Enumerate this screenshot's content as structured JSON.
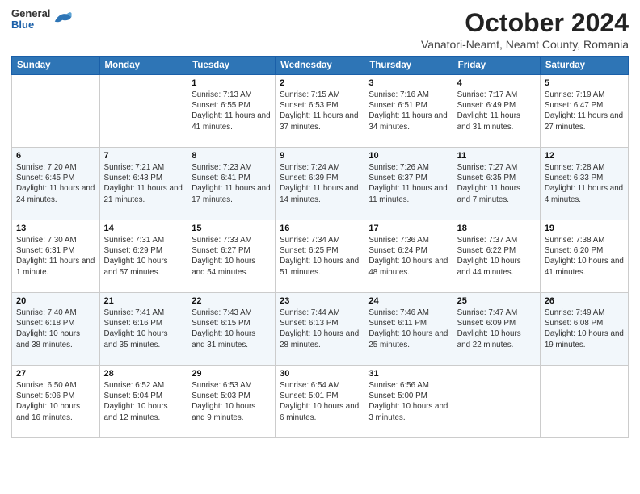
{
  "header": {
    "logo": {
      "general": "General",
      "blue": "Blue"
    },
    "title": "October 2024",
    "subtitle": "Vanatori-Neamt, Neamt County, Romania"
  },
  "weekdays": [
    "Sunday",
    "Monday",
    "Tuesday",
    "Wednesday",
    "Thursday",
    "Friday",
    "Saturday"
  ],
  "weeks": [
    [
      null,
      null,
      {
        "day": 1,
        "sunrise": "7:13 AM",
        "sunset": "6:55 PM",
        "daylight": "11 hours and 41 minutes."
      },
      {
        "day": 2,
        "sunrise": "7:15 AM",
        "sunset": "6:53 PM",
        "daylight": "11 hours and 37 minutes."
      },
      {
        "day": 3,
        "sunrise": "7:16 AM",
        "sunset": "6:51 PM",
        "daylight": "11 hours and 34 minutes."
      },
      {
        "day": 4,
        "sunrise": "7:17 AM",
        "sunset": "6:49 PM",
        "daylight": "11 hours and 31 minutes."
      },
      {
        "day": 5,
        "sunrise": "7:19 AM",
        "sunset": "6:47 PM",
        "daylight": "11 hours and 27 minutes."
      }
    ],
    [
      {
        "day": 6,
        "sunrise": "7:20 AM",
        "sunset": "6:45 PM",
        "daylight": "11 hours and 24 minutes."
      },
      {
        "day": 7,
        "sunrise": "7:21 AM",
        "sunset": "6:43 PM",
        "daylight": "11 hours and 21 minutes."
      },
      {
        "day": 8,
        "sunrise": "7:23 AM",
        "sunset": "6:41 PM",
        "daylight": "11 hours and 17 minutes."
      },
      {
        "day": 9,
        "sunrise": "7:24 AM",
        "sunset": "6:39 PM",
        "daylight": "11 hours and 14 minutes."
      },
      {
        "day": 10,
        "sunrise": "7:26 AM",
        "sunset": "6:37 PM",
        "daylight": "11 hours and 11 minutes."
      },
      {
        "day": 11,
        "sunrise": "7:27 AM",
        "sunset": "6:35 PM",
        "daylight": "11 hours and 7 minutes."
      },
      {
        "day": 12,
        "sunrise": "7:28 AM",
        "sunset": "6:33 PM",
        "daylight": "11 hours and 4 minutes."
      }
    ],
    [
      {
        "day": 13,
        "sunrise": "7:30 AM",
        "sunset": "6:31 PM",
        "daylight": "11 hours and 1 minute."
      },
      {
        "day": 14,
        "sunrise": "7:31 AM",
        "sunset": "6:29 PM",
        "daylight": "10 hours and 57 minutes."
      },
      {
        "day": 15,
        "sunrise": "7:33 AM",
        "sunset": "6:27 PM",
        "daylight": "10 hours and 54 minutes."
      },
      {
        "day": 16,
        "sunrise": "7:34 AM",
        "sunset": "6:25 PM",
        "daylight": "10 hours and 51 minutes."
      },
      {
        "day": 17,
        "sunrise": "7:36 AM",
        "sunset": "6:24 PM",
        "daylight": "10 hours and 48 minutes."
      },
      {
        "day": 18,
        "sunrise": "7:37 AM",
        "sunset": "6:22 PM",
        "daylight": "10 hours and 44 minutes."
      },
      {
        "day": 19,
        "sunrise": "7:38 AM",
        "sunset": "6:20 PM",
        "daylight": "10 hours and 41 minutes."
      }
    ],
    [
      {
        "day": 20,
        "sunrise": "7:40 AM",
        "sunset": "6:18 PM",
        "daylight": "10 hours and 38 minutes."
      },
      {
        "day": 21,
        "sunrise": "7:41 AM",
        "sunset": "6:16 PM",
        "daylight": "10 hours and 35 minutes."
      },
      {
        "day": 22,
        "sunrise": "7:43 AM",
        "sunset": "6:15 PM",
        "daylight": "10 hours and 31 minutes."
      },
      {
        "day": 23,
        "sunrise": "7:44 AM",
        "sunset": "6:13 PM",
        "daylight": "10 hours and 28 minutes."
      },
      {
        "day": 24,
        "sunrise": "7:46 AM",
        "sunset": "6:11 PM",
        "daylight": "10 hours and 25 minutes."
      },
      {
        "day": 25,
        "sunrise": "7:47 AM",
        "sunset": "6:09 PM",
        "daylight": "10 hours and 22 minutes."
      },
      {
        "day": 26,
        "sunrise": "7:49 AM",
        "sunset": "6:08 PM",
        "daylight": "10 hours and 19 minutes."
      }
    ],
    [
      {
        "day": 27,
        "sunrise": "6:50 AM",
        "sunset": "5:06 PM",
        "daylight": "10 hours and 16 minutes."
      },
      {
        "day": 28,
        "sunrise": "6:52 AM",
        "sunset": "5:04 PM",
        "daylight": "10 hours and 12 minutes."
      },
      {
        "day": 29,
        "sunrise": "6:53 AM",
        "sunset": "5:03 PM",
        "daylight": "10 hours and 9 minutes."
      },
      {
        "day": 30,
        "sunrise": "6:54 AM",
        "sunset": "5:01 PM",
        "daylight": "10 hours and 6 minutes."
      },
      {
        "day": 31,
        "sunrise": "6:56 AM",
        "sunset": "5:00 PM",
        "daylight": "10 hours and 3 minutes."
      },
      null,
      null
    ]
  ],
  "labels": {
    "sunrise": "Sunrise:",
    "sunset": "Sunset:",
    "daylight": "Daylight:"
  }
}
